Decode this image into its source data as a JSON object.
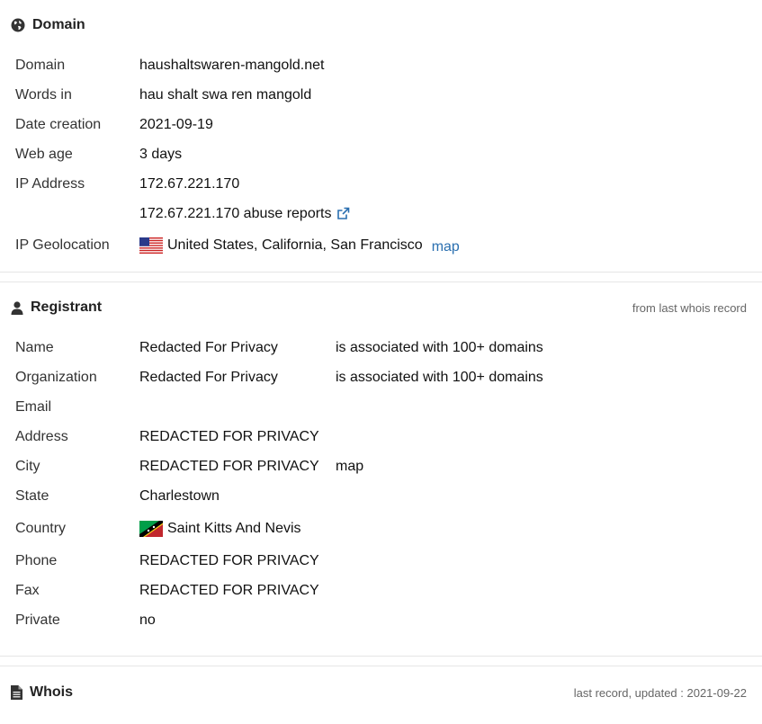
{
  "domain_section": {
    "title": "Domain",
    "rows": {
      "domain": {
        "label": "Domain",
        "value": "haushaltswaren-mangold.net"
      },
      "words": {
        "label": "Words in",
        "value": "hau shalt swa ren mangold"
      },
      "date_creation": {
        "label": "Date creation",
        "value": "2021-09-19"
      },
      "web_age": {
        "label": "Web age",
        "value": "3 days"
      },
      "ip": {
        "label": "IP Address",
        "value": "172.67.221.170",
        "abuse_link": "172.67.221.170 abuse reports"
      },
      "geo": {
        "label": "IP Geolocation",
        "value": "United States, California, San Francisco",
        "map": "map"
      }
    }
  },
  "registrant_section": {
    "title": "Registrant",
    "note": "from last whois record",
    "rows": {
      "name": {
        "label": "Name",
        "value": "Redacted For Privacy",
        "assoc": "is associated with 100+ domains"
      },
      "org": {
        "label": "Organization",
        "value": "Redacted For Privacy",
        "assoc": "is associated with 100+ domains"
      },
      "email": {
        "label": "Email",
        "value": ""
      },
      "address": {
        "label": "Address",
        "value": "REDACTED FOR PRIVACY"
      },
      "city": {
        "label": "City",
        "value": "REDACTED FOR PRIVACY",
        "map": "map"
      },
      "state": {
        "label": "State",
        "value": "Charlestown"
      },
      "country": {
        "label": "Country",
        "value": "Saint Kitts And Nevis"
      },
      "phone": {
        "label": "Phone",
        "value": "REDACTED FOR PRIVACY"
      },
      "fax": {
        "label": "Fax",
        "value": "REDACTED FOR PRIVACY"
      },
      "private": {
        "label": "Private",
        "value": "no"
      }
    }
  },
  "whois_section": {
    "title": "Whois",
    "note": "last record, updated : 2021-09-22"
  },
  "colors": {
    "link": "#2a6fb0",
    "text": "#222222",
    "muted": "#666666"
  },
  "icons": [
    "globe-icon",
    "user-icon",
    "document-icon",
    "external-link-icon",
    "us-flag-icon",
    "kn-flag-icon"
  ]
}
